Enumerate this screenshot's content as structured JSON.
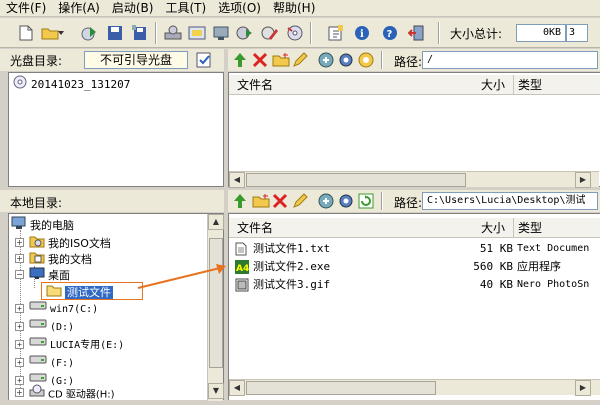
{
  "menu": [
    "文件(F)",
    "操作(A)",
    "启动(B)",
    "工具(T)",
    "选项(O)",
    "帮助(H)"
  ],
  "toolbar": {
    "total_size_label": "大小总计:",
    "total_size_value": "0KB",
    "total_size_suffix": "3"
  },
  "cd": {
    "label": "光盘目录:",
    "boot_status": "不可引导光盘",
    "path_label": "路径:",
    "path_value": "/",
    "tree_root": "20141023_131207",
    "cols": {
      "name": "文件名",
      "size": "大小",
      "type": "类型"
    }
  },
  "local": {
    "label": "本地目录:",
    "path_label": "路径:",
    "path_value": "C:\\Users\\Lucia\\Desktop\\测试",
    "tree": [
      {
        "label": "我的电脑"
      },
      {
        "label": "我的ISO文档"
      },
      {
        "label": "我的文档"
      },
      {
        "label": "桌面"
      },
      {
        "label": "测试文件"
      },
      {
        "label": "win7(C:)"
      },
      {
        "label": "(D:)"
      },
      {
        "label": "LUCIA专用(E:)"
      },
      {
        "label": "(F:)"
      },
      {
        "label": "(G:)"
      },
      {
        "label": "CD 驱动器(H:)"
      }
    ],
    "cols": {
      "name": "文件名",
      "size": "大小",
      "type": "类型"
    },
    "files": [
      {
        "name": "测试文件1.txt",
        "size": "51 KB",
        "type": "Text Documen"
      },
      {
        "name": "测试文件2.exe",
        "size": "560 KB",
        "type": "应用程序"
      },
      {
        "name": "测试文件3.gif",
        "size": "40 KB",
        "type": "Nero PhotoSn"
      }
    ]
  },
  "colors": {
    "accent_arrow": "#e8731e",
    "selection": "#316ac5"
  }
}
